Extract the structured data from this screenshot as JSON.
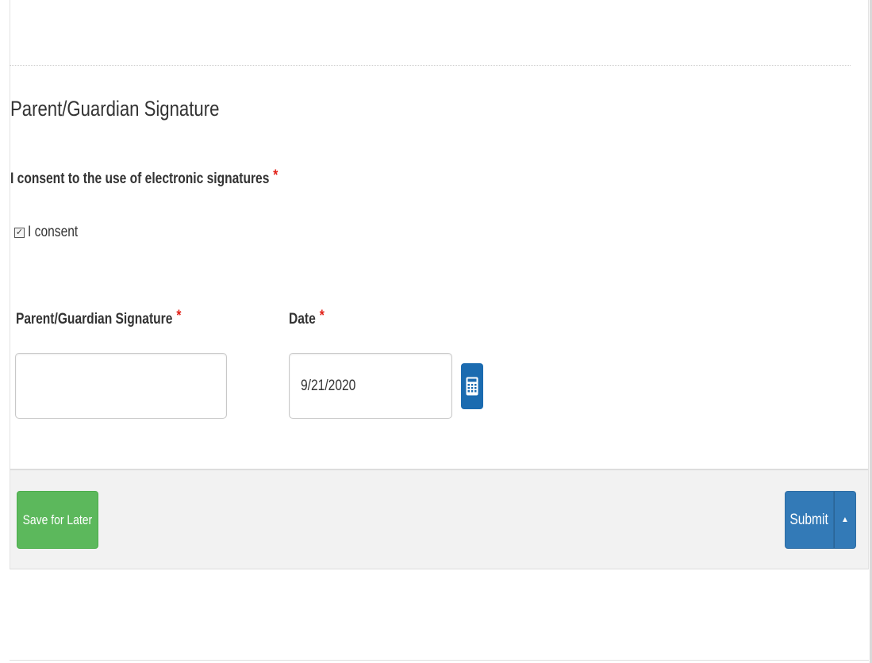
{
  "section": {
    "title": "Parent/Guardian Signature"
  },
  "consent": {
    "question": "I consent to the use of electronic signatures",
    "required_mark": "*",
    "option_label": "I consent",
    "checked": true
  },
  "fields": {
    "signature": {
      "label": "Parent/Guardian Signature",
      "required_mark": "*",
      "value": ""
    },
    "date": {
      "label": "Date",
      "required_mark": "*",
      "value": "9/21/2020",
      "picker_icon": "calendar-icon"
    }
  },
  "footer": {
    "save_label": "Save for Later",
    "submit_label": "Submit",
    "submit_menu_icon": "caret-up-icon"
  },
  "colors": {
    "required": "#e2231a",
    "save_button": "#5cb85c",
    "submit_button": "#337ab7",
    "calendar_button": "#1b6bb0"
  }
}
